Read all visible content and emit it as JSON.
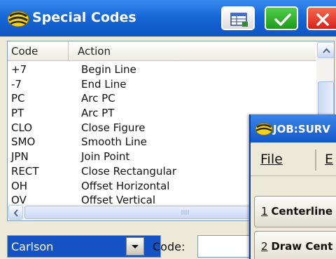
{
  "dialog": {
    "title": "Special Codes",
    "icons": {
      "logo": "carlson-logo-icon",
      "table": "table-icon",
      "ok": "checkmark-icon",
      "close": "close-icon"
    }
  },
  "list": {
    "headers": {
      "code": "Code",
      "action": "Action"
    },
    "rows": [
      {
        "code": "+7",
        "action": "Begin Line"
      },
      {
        "code": "-7",
        "action": "End Line"
      },
      {
        "code": "PC",
        "action": "Arc PC"
      },
      {
        "code": "PT",
        "action": "Arc PT"
      },
      {
        "code": "CLO",
        "action": "Close Figure"
      },
      {
        "code": "SMO",
        "action": "Smooth Line"
      },
      {
        "code": "JPN",
        "action": "Join Point"
      },
      {
        "code": "RECT",
        "action": "Close Rectangular"
      },
      {
        "code": "OH",
        "action": "Offset Horizontal"
      },
      {
        "code": "OV",
        "action": "Offset Vertical"
      }
    ]
  },
  "footer": {
    "combo_value": "Carlson",
    "code_label": "Code:",
    "code_value": ""
  },
  "job_window": {
    "title": "JOB:SURV",
    "menu": {
      "file": "File",
      "second": "E"
    },
    "buttons": {
      "one_num": "1",
      "one_label": "Centerline",
      "two_num": "2",
      "two_label": "Draw Cent"
    }
  },
  "colors": {
    "titlebar": "#1767d6",
    "selection": "#1553c4",
    "ok": "#2aa626",
    "close": "#e23a2a"
  }
}
